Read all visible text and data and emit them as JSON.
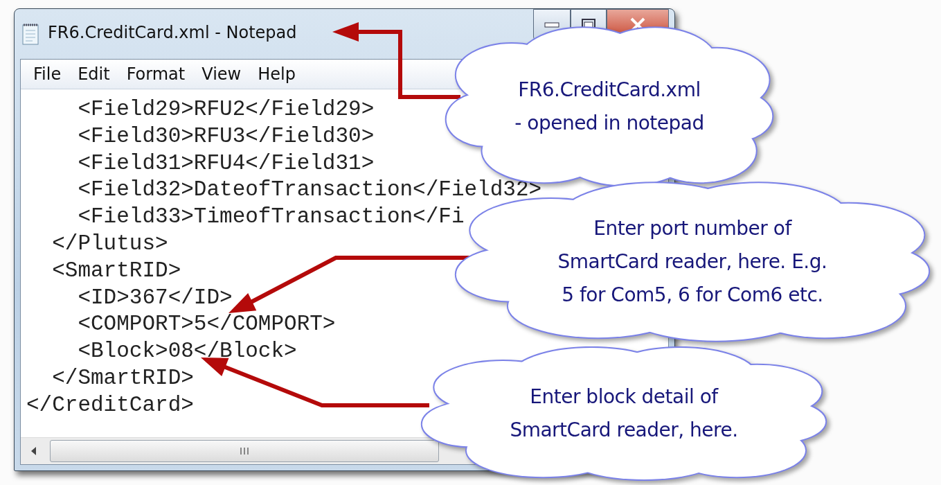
{
  "window": {
    "title": "FR6.CreditCard.xml - Notepad"
  },
  "menu": [
    "File",
    "Edit",
    "Format",
    "View",
    "Help"
  ],
  "editor": {
    "lines": [
      "    <Field29>RFU2</Field29>",
      "    <Field30>RFU3</Field30>",
      "    <Field31>RFU4</Field31>",
      "    <Field32>DateofTransaction</Field32>",
      "    <Field33>TimeofTransaction</Fi",
      "  </Plutus>",
      "  <SmartRID>",
      "    <ID>367</ID>",
      "    <COMPORT>5</COMPORT>",
      "    <Block>08</Block>",
      "  </SmartRID>",
      "</CreditCard>"
    ]
  },
  "callouts": [
    {
      "text": "FR6.CreditCard.xml\n- opened in notepad"
    },
    {
      "text": "Enter port number of\nSmartCard reader, here. E.g.\n5 for Com5, 6 for Com6 etc."
    },
    {
      "text": "Enter block detail of\nSmartCard reader, here."
    }
  ]
}
